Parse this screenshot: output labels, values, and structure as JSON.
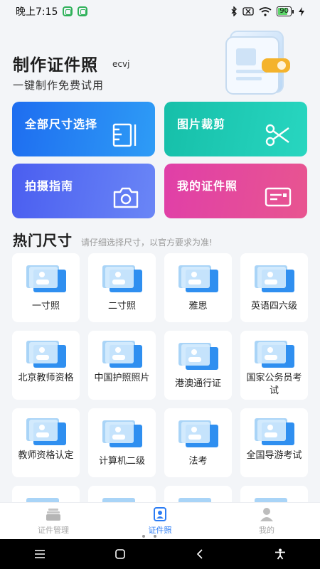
{
  "status": {
    "time": "晚上7:15",
    "battery": "90"
  },
  "header": {
    "title": "制作证件照",
    "code": "ecvj",
    "subtitle": "一键制作免费试用"
  },
  "features": [
    {
      "label": "全部尺寸选择",
      "icon": "ruler-icon"
    },
    {
      "label": "图片裁剪",
      "icon": "scissors-icon"
    },
    {
      "label": "拍摄指南",
      "icon": "camera-icon"
    },
    {
      "label": "我的证件照",
      "icon": "id-card-icon"
    }
  ],
  "sizes_section": {
    "title": "热门尺寸",
    "hint": "请仔细选择尺寸，以官方要求为准!"
  },
  "sizes": [
    {
      "name": "一寸照"
    },
    {
      "name": "二寸照"
    },
    {
      "name": "雅思"
    },
    {
      "name": "英语四六级"
    },
    {
      "name": "北京教师资格"
    },
    {
      "name": "中国护照照片"
    },
    {
      "name": "港澳通行证"
    },
    {
      "name": "国家公务员考试"
    },
    {
      "name": "教师资格认定"
    },
    {
      "name": "计算机二级"
    },
    {
      "name": "法考"
    },
    {
      "name": "全国导游考试"
    }
  ],
  "tabs": [
    {
      "label": "证件管理",
      "icon": "folder-stack-icon",
      "active": false
    },
    {
      "label": "证件照",
      "icon": "id-photo-icon",
      "active": true
    },
    {
      "label": "我的",
      "icon": "user-icon",
      "active": false
    }
  ],
  "colors": {
    "accent": "#2b7cf4",
    "blue": "#1e6df0",
    "teal": "#16bfa9",
    "indigo": "#4a5ef0",
    "pink": "#e03fa8"
  }
}
